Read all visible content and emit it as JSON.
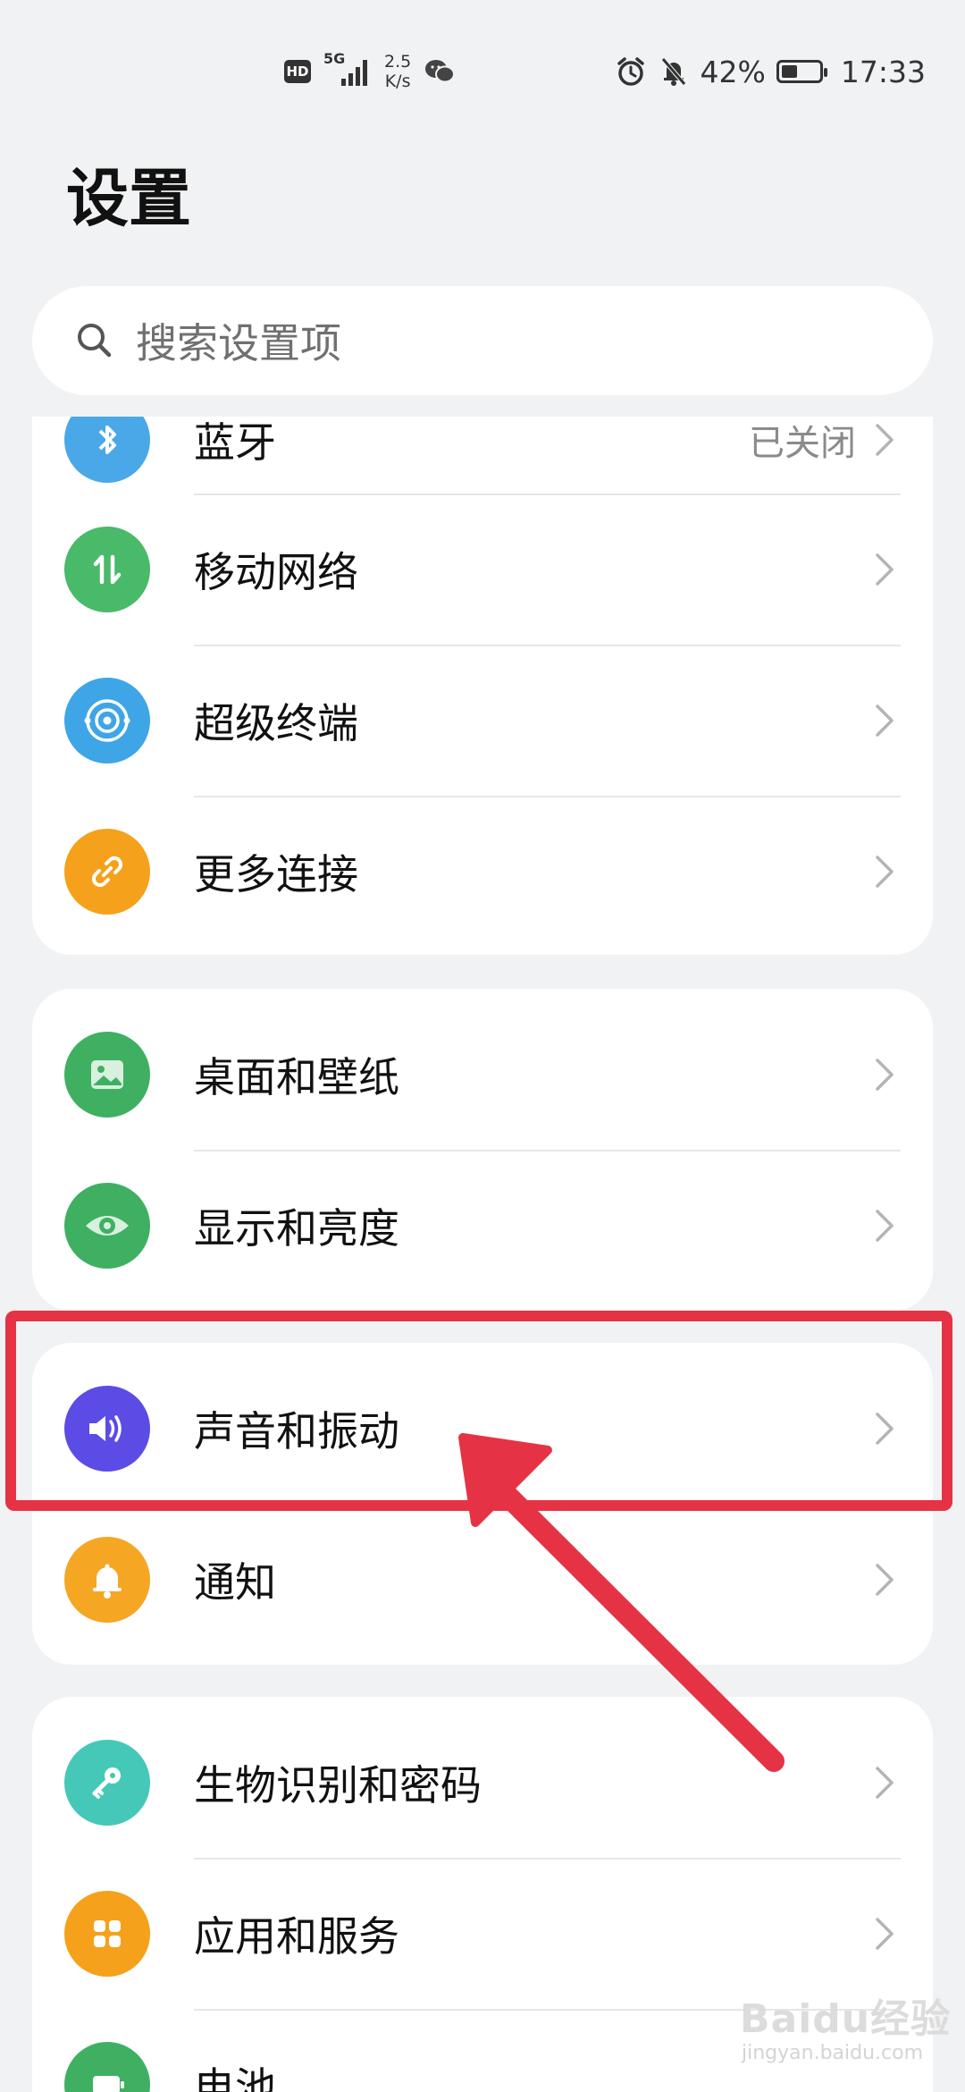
{
  "status_bar": {
    "hd": "HD",
    "network": "5G",
    "speed_value": "2.5",
    "speed_unit": "K/s",
    "battery_percent": "42%",
    "battery_level": 0.42,
    "time": "17:33"
  },
  "page": {
    "title": "设置"
  },
  "search": {
    "placeholder": "搜索设置项"
  },
  "card1": {
    "items": [
      {
        "label": "蓝牙",
        "value": "已关闭",
        "icon": "bluetooth-icon",
        "color": "#4aa8e8"
      },
      {
        "label": "移动网络",
        "icon": "mobile-data-icon",
        "color": "#49b96a"
      },
      {
        "label": "超级终端",
        "icon": "super-device-icon",
        "color": "#3ea6e6"
      },
      {
        "label": "更多连接",
        "icon": "link-icon",
        "color": "#f6a11b"
      }
    ]
  },
  "card2": {
    "items": [
      {
        "label": "桌面和壁纸",
        "icon": "wallpaper-icon",
        "color": "#3fb062"
      },
      {
        "label": "显示和亮度",
        "icon": "eye-icon",
        "color": "#3fb062"
      }
    ]
  },
  "card3": {
    "items": [
      {
        "label": "声音和振动",
        "icon": "speaker-icon",
        "color": "#5b4ce6"
      },
      {
        "label": "通知",
        "icon": "bell-icon",
        "color": "#f5a623"
      }
    ]
  },
  "card4": {
    "items": [
      {
        "label": "生物识别和密码",
        "icon": "key-icon",
        "color": "#45c8b8"
      },
      {
        "label": "应用和服务",
        "icon": "apps-icon",
        "color": "#f6a11b"
      },
      {
        "label": "电池",
        "icon": "battery-icon",
        "color": "#3fb062"
      }
    ]
  },
  "annotation": {
    "highlight_color": "#e53345"
  },
  "watermark": {
    "text": "Baidu经验",
    "sub": "jingyan.baidu.com"
  }
}
